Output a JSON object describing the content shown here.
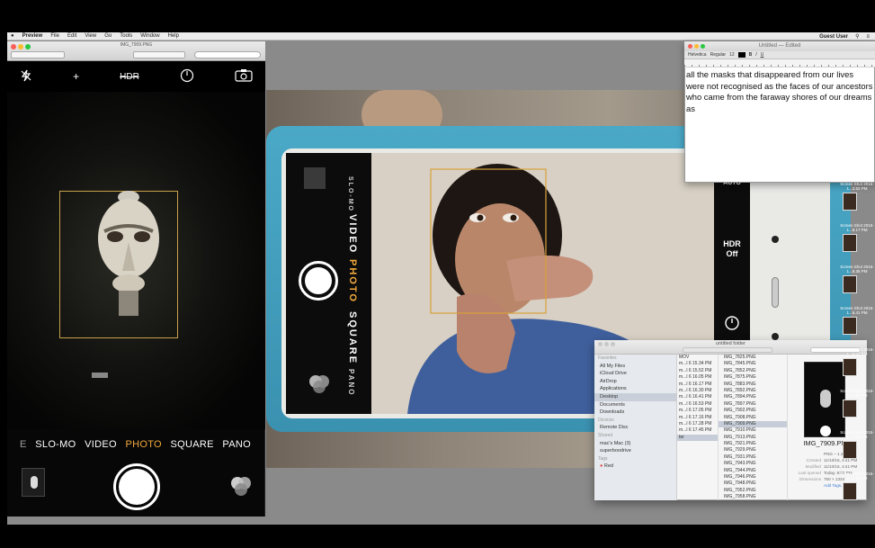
{
  "menubar": {
    "items": [
      "Preview",
      "File",
      "Edit",
      "View",
      "Go",
      "Tools",
      "Window",
      "Help"
    ],
    "user": "Guest User"
  },
  "preview_window": {
    "title": "IMG_7909.PNG"
  },
  "iphone": {
    "flash_icon": "flash-off-icon",
    "hdr": "HDR",
    "modes": [
      "E",
      "SLO-MO",
      "VIDEO",
      "PHOTO",
      "SQUARE",
      "PANO"
    ],
    "active_mode": "PHOTO"
  },
  "scene_phone": {
    "modes": [
      "SLO-MO",
      "VIDEO",
      "PHOTO",
      "SQUARE",
      "PANO"
    ],
    "active_mode": "PHOTO",
    "top_right": "AUTO",
    "hdr": "HDR\nOff"
  },
  "textedit": {
    "title": "Untitled — Edited",
    "toolbar": [
      "Helvetica",
      "Regular",
      "12"
    ],
    "body": "all the masks that disappeared from our lives were not recognised as the faces of our ancestors who came from the faraway shores of our dreams as"
  },
  "finder": {
    "title": "untitled folder",
    "favorites_header": "Favorites",
    "favorites": [
      "All My Files",
      "iCloud Drive",
      "AirDrop",
      "Applications",
      "Desktop",
      "Documents",
      "Downloads"
    ],
    "devices_header": "Devices",
    "devices": [
      "Remote Disc"
    ],
    "shared_header": "Shared",
    "shared": [
      "mac's Mac (3)",
      "superboodrive"
    ],
    "tags_header": "Tags",
    "tags": [
      "Red"
    ],
    "col_a": [
      "MOV",
      "m...l 6 15.34 PM",
      "m...l 6 15.52 PM",
      "m...l 6 16.05 PM",
      "m...l 6 16.17 PM",
      "m...l 6 16.30 PM",
      "m...l 6 16.41 PM",
      "m...l 6 16.53 PM",
      "m...l 6 17.05 PM",
      "m...l 6 17.16 PM",
      "m...l 6 17.28 PM",
      "m...l 6 17.45 PM",
      "ter"
    ],
    "col_b": [
      "IMG_7825.PNG",
      "IMG_7845.PNG",
      "IMG_7852.PNG",
      "IMG_7875.PNG",
      "IMG_7883.PNG",
      "IMG_7892.PNG",
      "IMG_7894.PNG",
      "IMG_7897.PNG",
      "IMG_7902.PNG",
      "IMG_7908.PNG",
      "IMG_7909.PNG",
      "IMG_7910.PNG",
      "IMG_7913.PNG",
      "IMG_7921.PNG",
      "IMG_7929.PNG",
      "IMG_7931.PNG",
      "IMG_7943.PNG",
      "IMG_7944.PNG",
      "IMG_7946.PNG",
      "IMG_7948.PNG",
      "IMG_7952.PNG",
      "IMG_7958.PNG",
      "IMG_7970.PNG"
    ],
    "selected_b": "IMG_7909.PNG",
    "preview_name": "IMG_7909.PNG",
    "info": [
      {
        "k": "",
        "v": "PNG – 1.3 MB"
      },
      {
        "k": "Created",
        "v": "11/10/15, 4:41 PM"
      },
      {
        "k": "Modified",
        "v": "11/10/15, 4:41 PM"
      },
      {
        "k": "Last opened",
        "v": "Today, 9:02 PM"
      },
      {
        "k": "Dimensions",
        "v": "750 × 1334"
      },
      {
        "k": "",
        "v": "Add Tags..."
      }
    ]
  },
  "stack": {
    "labels": [
      "Screen Shot 2015-1...2.52 PM",
      "Screen Shot 2015-1...8.17 PM",
      "Screen Shot 2015-1...6.35 PM",
      "Screen Shot 2015-1...6.41 PM",
      "Screen Shot 2015-1...6.42 PM",
      "Screen Shot 2015-1...7.05 PM",
      "Screen Shot 2015-1...7.16 PM",
      "Screen Shot 2015-1...7.28 PM"
    ]
  }
}
